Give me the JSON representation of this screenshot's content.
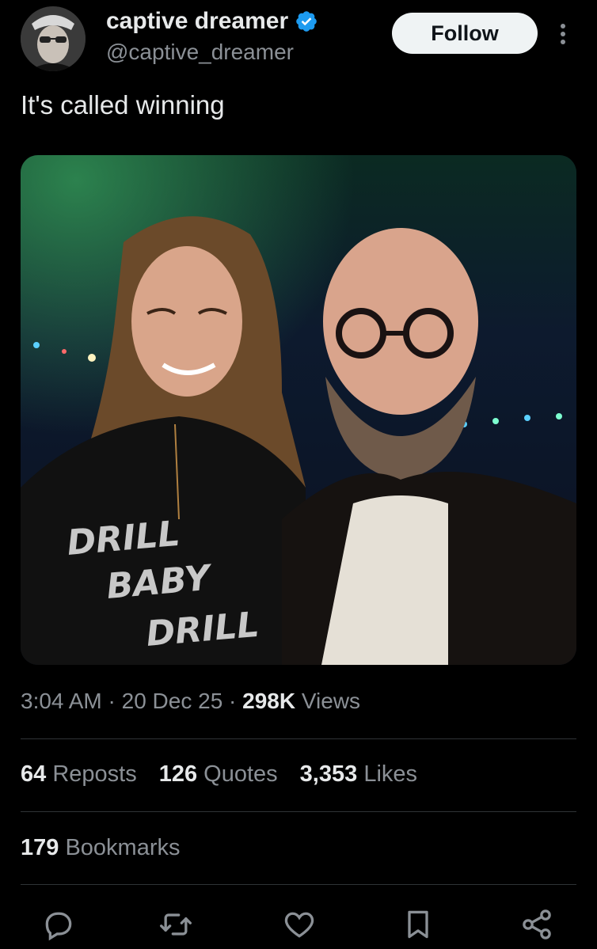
{
  "author": {
    "name": "captive dreamer",
    "handle": "@captive_dreamer",
    "verified": true,
    "avatar_icon": "avatar-photo"
  },
  "follow_label": "Follow",
  "tweet": {
    "text": "It's called winning",
    "photo_shirt_text": [
      "DRILL",
      "BABY",
      "DRILL"
    ],
    "time": "3:04 AM",
    "date": "20 Dec 25",
    "views_count": "298K",
    "views_label": "Views"
  },
  "stats": {
    "reposts_count": "64",
    "reposts_label": "Reposts",
    "quotes_count": "126",
    "quotes_label": "Quotes",
    "likes_count": "3,353",
    "likes_label": "Likes",
    "bookmarks_count": "179",
    "bookmarks_label": "Bookmarks"
  },
  "actions": [
    "reply-icon",
    "repost-icon",
    "like-icon",
    "bookmark-icon",
    "share-icon"
  ],
  "colors": {
    "background": "#000000",
    "text": "#e7e9ea",
    "secondary": "#8b9096",
    "verified": "#1d9bf0",
    "divider": "#2f3336"
  }
}
